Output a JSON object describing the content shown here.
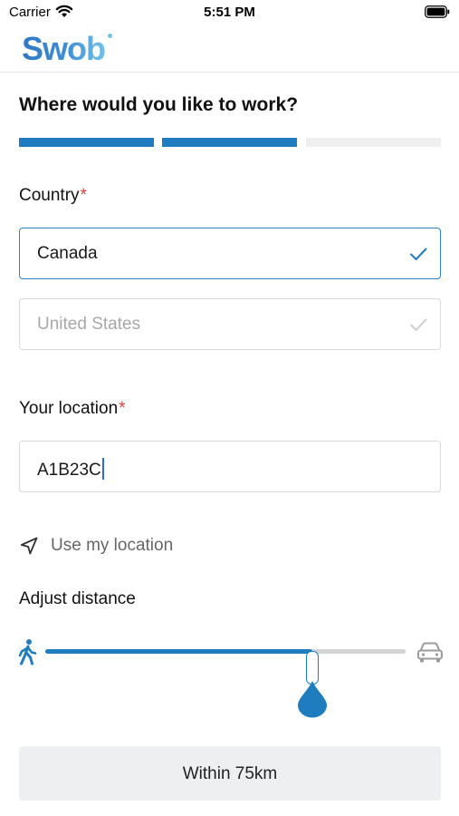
{
  "status_bar": {
    "carrier": "Carrier",
    "time": "5:51 PM",
    "icons": [
      "wifi-icon",
      "battery-icon"
    ]
  },
  "header": {
    "logo_text": "Swob",
    "logo_colors": [
      "#2f78c4",
      "#3f8fd6",
      "#6fc1ea"
    ]
  },
  "page": {
    "title": "Where would you like to work?",
    "progress": {
      "total_steps": 3,
      "completed_steps": 2,
      "active_color": "#1f7dbf",
      "inactive_color": "#efefef"
    }
  },
  "country": {
    "label": "Country",
    "required_mark": "*",
    "options": [
      {
        "label": "Canada",
        "selected": true
      },
      {
        "label": "United States",
        "selected": false
      }
    ]
  },
  "location": {
    "label": "Your location",
    "required_mark": "*",
    "value": "A1B23C",
    "use_my_location": "Use my location",
    "icon": "navigation-arrow-icon"
  },
  "distance": {
    "label": "Adjust distance",
    "slider_fraction": 0.74,
    "min_icon": "walking-person-icon",
    "max_icon": "car-icon",
    "within_label": "Within 75km"
  },
  "colors": {
    "accent": "#1f7dbf",
    "required": "#e0403a",
    "caret": "#2f63e8"
  }
}
